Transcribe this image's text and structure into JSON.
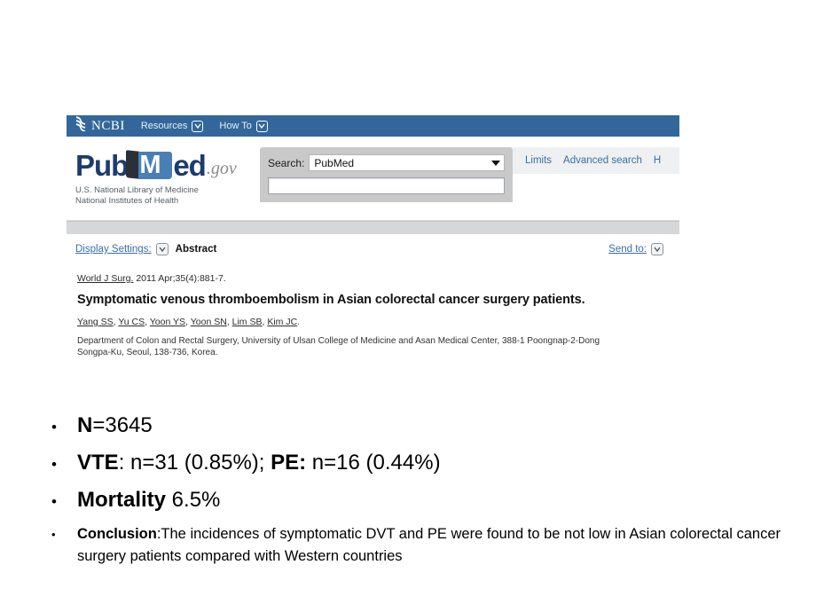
{
  "screenshot": {
    "ncbi_bar": {
      "logo_icon": "ncbi-helix-icon",
      "logo_text": "NCBI",
      "menu": [
        {
          "label": "Resources",
          "icon": "chevron-down-icon"
        },
        {
          "label": "How To",
          "icon": "chevron-down-icon"
        }
      ]
    },
    "pubmed_logo": {
      "part1": "Pub",
      "book_letter": "M",
      "part2": "ed",
      "suffix": ".gov",
      "subtitle_line1": "U.S. National Library of Medicine",
      "subtitle_line2": "National Institutes of Health"
    },
    "search": {
      "label": "Search:",
      "database": "PubMed",
      "query_value": "",
      "query_placeholder": "",
      "dropdown_icon": "caret-down-icon"
    },
    "header_links": [
      {
        "label": "Limits"
      },
      {
        "label": "Advanced search"
      },
      {
        "label": "H"
      }
    ],
    "display_bar": {
      "display_settings_label": "Display Settings:",
      "display_settings_icon": "chevron-down-icon",
      "display_mode": "Abstract",
      "send_to_label": "Send to:",
      "send_to_icon": "chevron-down-icon"
    },
    "record": {
      "journal": "World J Surg.",
      "citation": "2011 Apr;35(4):881-7.",
      "title": "Symptomatic venous thromboembolism in Asian colorectal cancer surgery patients.",
      "authors": [
        "Yang SS",
        "Yu CS",
        "Yoon YS",
        "Yoon SN",
        "Lim SB",
        "Kim JC"
      ],
      "affiliation": "Department of Colon and Rectal Surgery, University of Ulsan College of Medicine and Asan Medical Center, 388-1 Poongnap-2-Dong Songpa-Ku, Seoul, 138-736, Korea."
    },
    "colors": {
      "ncbi_bar_blue": "#33679b",
      "link_blue": "#3a6ea5",
      "logo_navy": "#1c3c6e",
      "book_blue": "#4a7fb5",
      "panel_gray": "#c9c9c9"
    }
  },
  "bullets": {
    "marker": "•",
    "items": [
      {
        "bold": "N",
        "rest": "=3645"
      },
      {
        "bold": "VTE",
        "rest": ": n=31 (0.85%); ",
        "bold2": "PE:",
        "rest2": " n=16 (0.44%)"
      },
      {
        "bold": "Mortality",
        "rest": " 6.5%"
      }
    ],
    "conclusion": {
      "bold": "Conclusion",
      "rest": ":The incidences of symptomatic DVT and PE were found to be not low in Asian colorectal cancer surgery patients compared with Western countries"
    }
  }
}
